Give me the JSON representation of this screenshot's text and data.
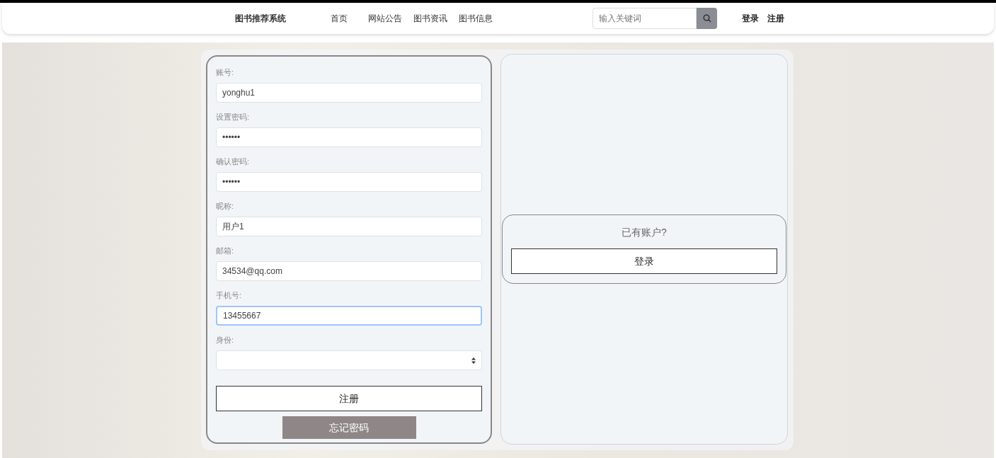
{
  "header": {
    "title": "图书推荐系统",
    "nav": [
      {
        "label": "首页"
      },
      {
        "label": "网站公告"
      },
      {
        "label": "图书资讯"
      },
      {
        "label": "图书信息"
      }
    ],
    "search": {
      "placeholder": "输入关键词"
    },
    "auth_links": [
      {
        "label": "登录"
      },
      {
        "label": "注册"
      }
    ]
  },
  "register_form": {
    "fields": [
      {
        "kind": "text",
        "label": "账号:",
        "value": "yonghu1",
        "focused": false
      },
      {
        "kind": "text",
        "label": "设置密码:",
        "value": "••••••",
        "focused": false
      },
      {
        "kind": "text",
        "label": "确认密码:",
        "value": "••••••",
        "focused": false
      },
      {
        "kind": "text",
        "label": "昵称:",
        "value": "用户1",
        "focused": false
      },
      {
        "kind": "text",
        "label": "邮箱:",
        "value": "34534@qq.com",
        "focused": false
      },
      {
        "kind": "text",
        "label": "手机号:",
        "value": "13455667",
        "focused": true
      },
      {
        "kind": "select",
        "label": "身份:",
        "focused": false
      }
    ],
    "submit": "注册",
    "forgot": "忘记密码"
  },
  "login_panel": {
    "prompt": "已有账户?",
    "button": "登录"
  }
}
